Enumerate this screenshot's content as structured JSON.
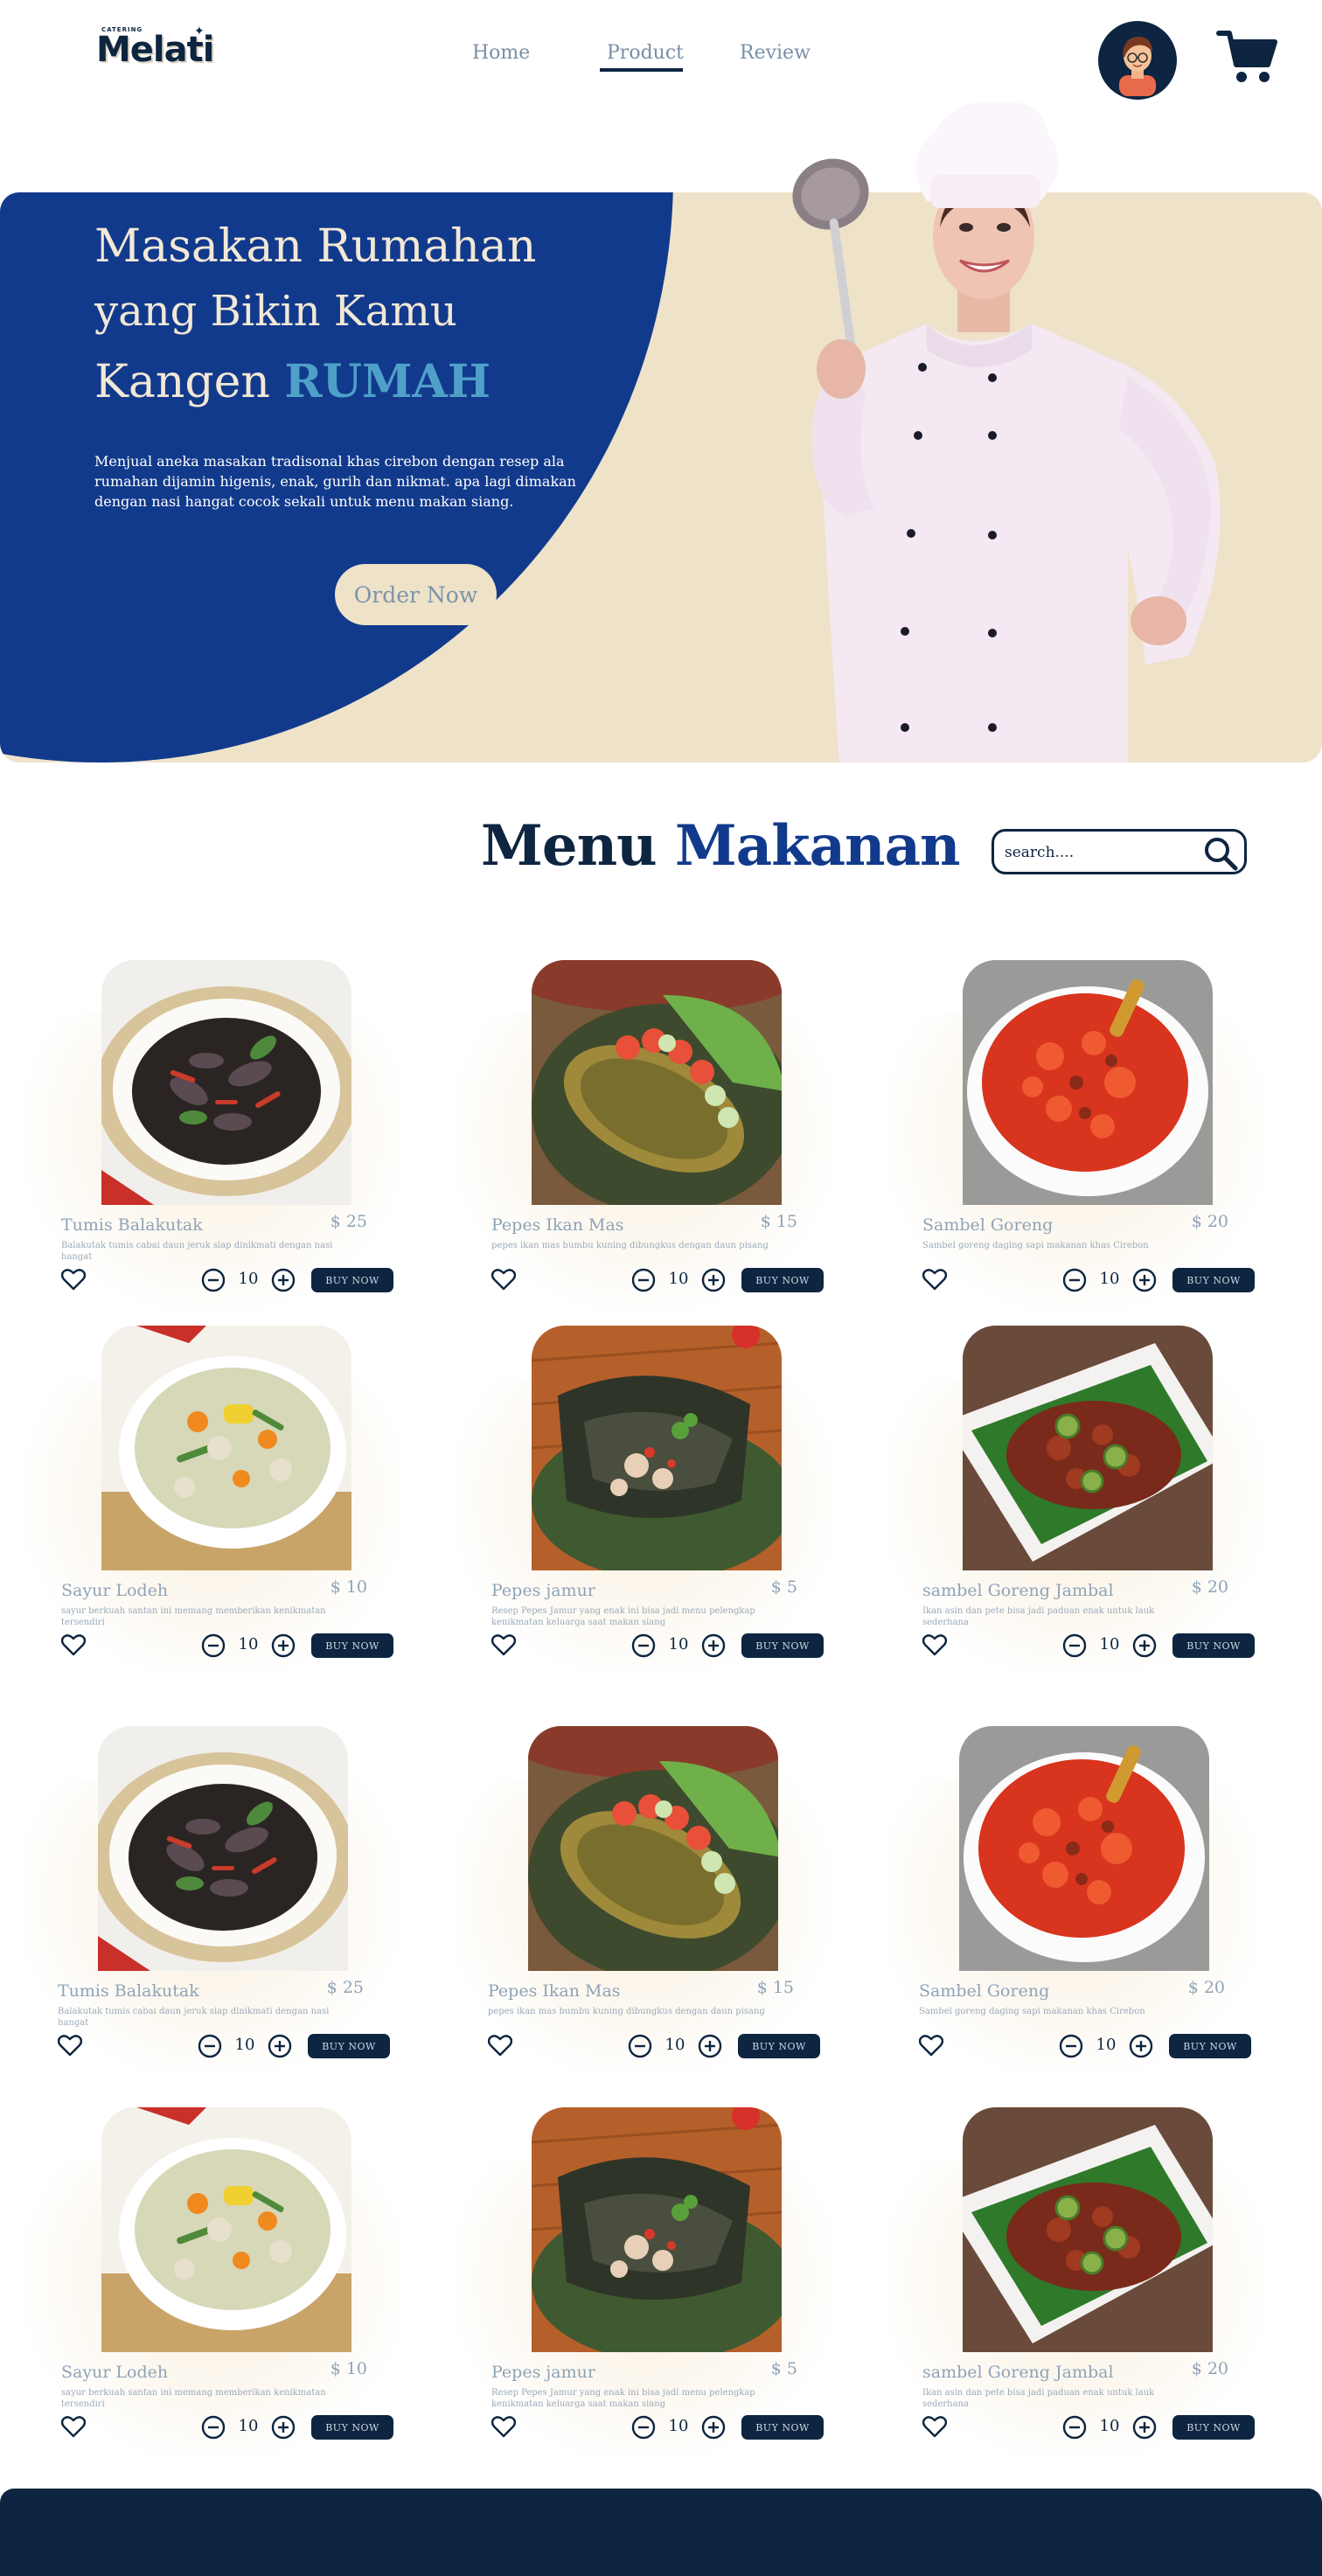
{
  "nav": {
    "logo_small": "CATERING",
    "logo_text": "Melati",
    "links": [
      "Home",
      "Product",
      "Review"
    ],
    "active": "Product"
  },
  "hero": {
    "title_line1": "Masakan Rumahan",
    "title_line2": "yang Bikin Kamu",
    "title_line3_a": "Kangen ",
    "title_line3_b": "RUMAH",
    "description": "Menjual aneka masakan tradisonal khas cirebon dengan resep ala rumahan dijamin higenis, enak, gurih dan nikmat. apa lagi dimakan dengan nasi hangat cocok sekali untuk menu makan siang.",
    "cta": "Order Now"
  },
  "menu": {
    "title_a": "Menu ",
    "title_b": "Makanan",
    "search_placeholder": "search....",
    "buy_label": "BUY NOW",
    "items": [
      {
        "name": "Tumis Balakutak",
        "price": "$ 25",
        "desc": "Balakutak tumis cabai daun jeruk siap dinikmati dengan nasi hangat",
        "qty": "10",
        "photo": "squid"
      },
      {
        "name": "Pepes Ikan Mas",
        "price": "$ 15",
        "desc": "pepes ikan mas bumbu kuning dibungkus dengan daun pisang",
        "qty": "10",
        "photo": "fish"
      },
      {
        "name": "Sambel Goreng",
        "price": "$ 20",
        "desc": "Sambel goreng daging sapi makanan khas Cirebon",
        "qty": "10",
        "photo": "sambal"
      },
      {
        "name": "Sayur Lodeh",
        "price": "$ 10",
        "desc": "sayur berkuah santan ini memang memberikan kenikmatan tersendiri",
        "qty": "10",
        "photo": "lodeh"
      },
      {
        "name": "Pepes jamur",
        "price": "$ 5",
        "desc": "Resep Pepes Jamur yang enak ini bisa jadi menu pelengkap kenikmatan keluarga saat makan siang",
        "qty": "10",
        "photo": "pepes"
      },
      {
        "name": "sambel Goreng Jambal",
        "price": "$ 20",
        "desc": "Ikan asin dan pete bisa jadi paduan enak untuk lauk sederhana",
        "qty": "10",
        "photo": "jambal"
      },
      {
        "name": "Tumis Balakutak",
        "price": "$ 25",
        "desc": "Balakutak tumis cabai daun jeruk siap dinikmati dengan nasi hangat",
        "qty": "10",
        "photo": "squid"
      },
      {
        "name": "Pepes Ikan Mas",
        "price": "$ 15",
        "desc": "pepes ikan mas bumbu kuning dibungkus dengan daun pisang",
        "qty": "10",
        "photo": "fish"
      },
      {
        "name": "Sambel Goreng",
        "price": "$ 20",
        "desc": "Sambel goreng daging sapi makanan khas Cirebon",
        "qty": "10",
        "photo": "sambal"
      },
      {
        "name": "Sayur Lodeh",
        "price": "$ 10",
        "desc": "sayur berkuah santan ini memang memberikan kenikmatan tersendiri",
        "qty": "10",
        "photo": "lodeh"
      },
      {
        "name": "Pepes jamur",
        "price": "$ 5",
        "desc": "Resep Pepes Jamur yang enak ini bisa jadi menu pelengkap kenikmatan keluarga saat makan siang",
        "qty": "10",
        "photo": "pepes"
      },
      {
        "name": "sambel Goreng Jambal",
        "price": "$ 20",
        "desc": "Ikan asin dan pete bisa jadi paduan enak untuk lauk sederhana",
        "qty": "10",
        "photo": "jambal"
      }
    ]
  },
  "colors": {
    "navy": "#0d2540",
    "hero_blue": "#123a8c",
    "cream": "#eee3c9",
    "accent_teal": "#4fa0c9"
  }
}
